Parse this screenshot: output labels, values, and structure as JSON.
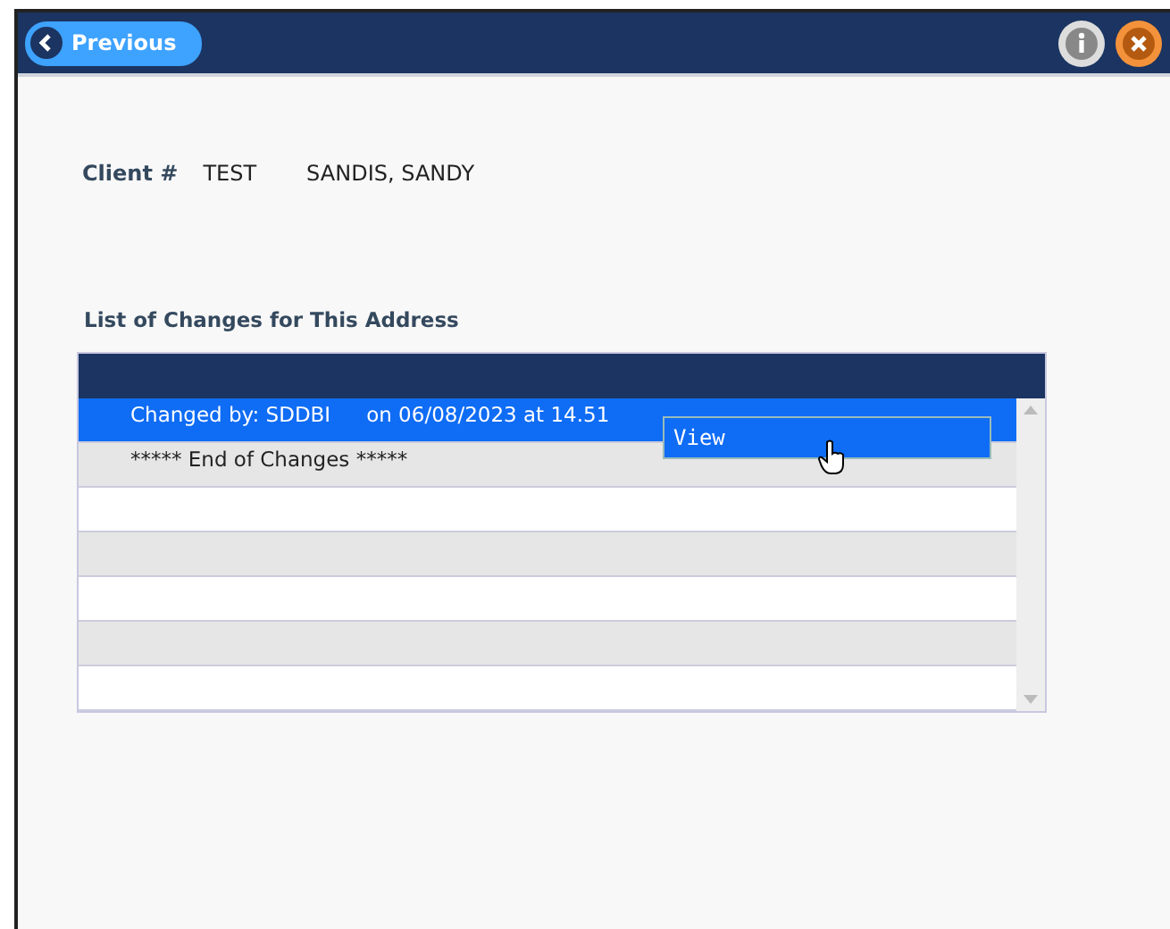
{
  "header": {
    "back_button": "Previous"
  },
  "client": {
    "label": "Client #",
    "number": "TEST",
    "name": "SANDIS, SANDY"
  },
  "changes": {
    "title": "List of Changes for This Address",
    "rows": [
      {
        "kind": "change",
        "changed_by": "Changed by: SDDBI",
        "when": "on 06/08/2023 at 14.51",
        "selected": true
      },
      {
        "kind": "end",
        "text": "***** End of Changes *****",
        "selected": false
      },
      {
        "kind": "blank",
        "selected": false
      },
      {
        "kind": "blank",
        "selected": false
      },
      {
        "kind": "blank",
        "selected": false
      },
      {
        "kind": "blank",
        "selected": false
      },
      {
        "kind": "blank",
        "selected": false
      }
    ],
    "context_menu": {
      "items": [
        "View"
      ]
    }
  }
}
